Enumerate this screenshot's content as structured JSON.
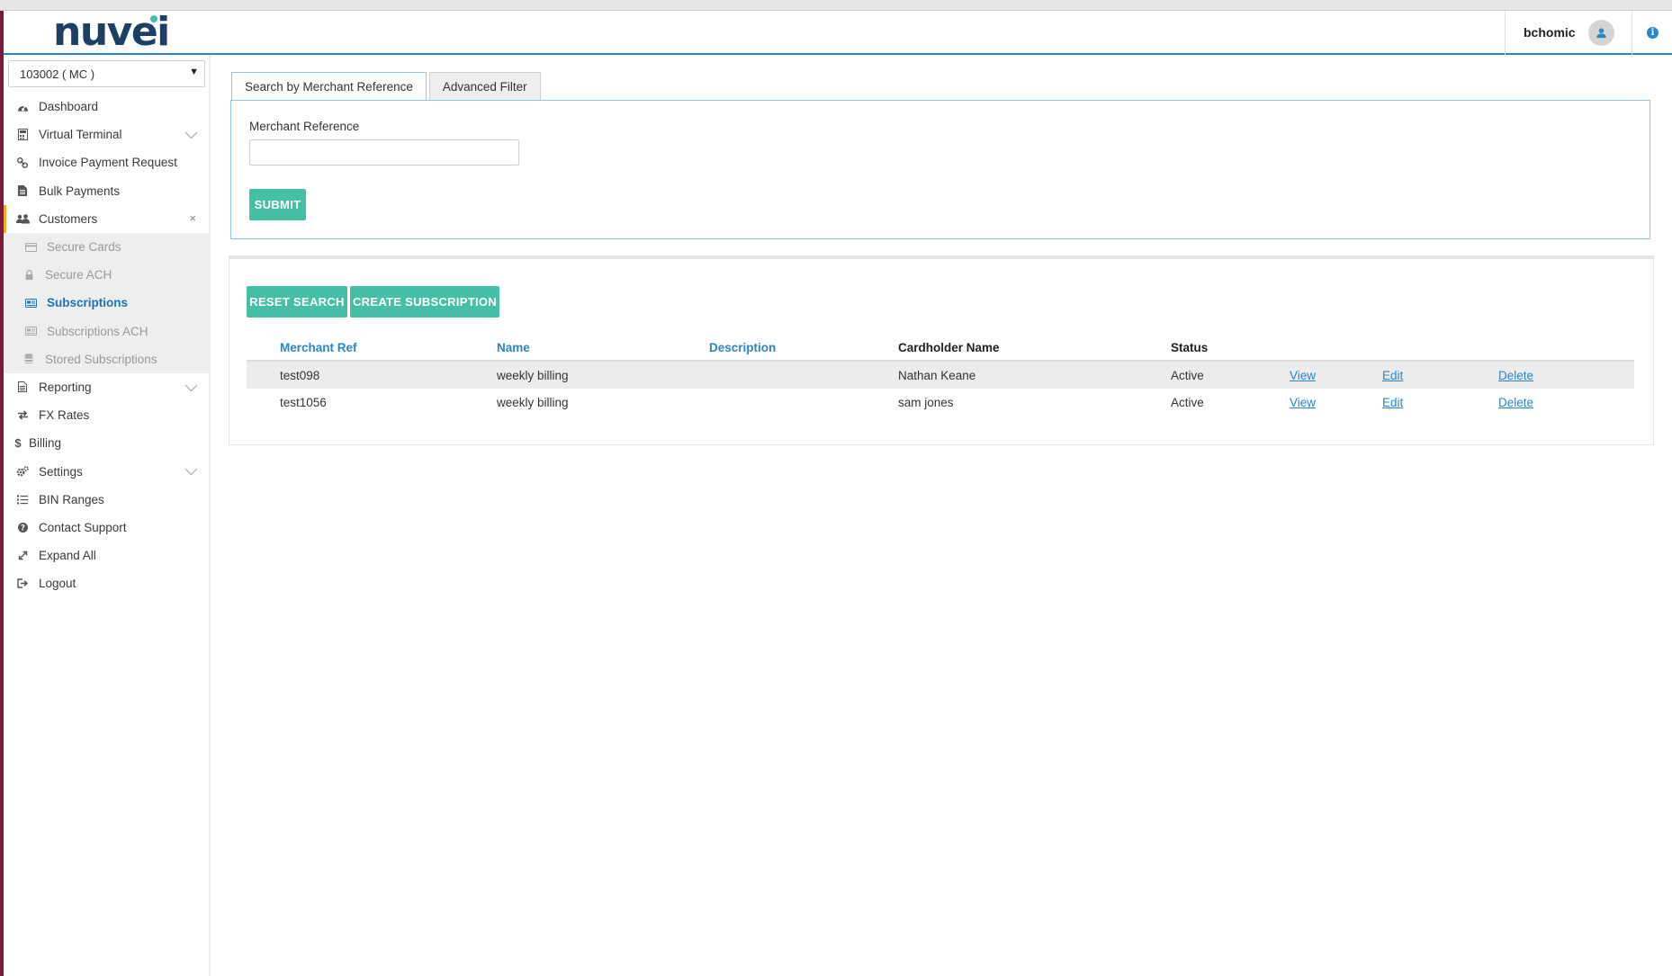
{
  "header": {
    "logo_text": "nuvei",
    "username": "bchomic"
  },
  "sidebar": {
    "account_select": "103002 ( MC )",
    "items": [
      {
        "label": "Dashboard",
        "icon": "dashboard-icon"
      },
      {
        "label": "Virtual Terminal",
        "icon": "calculator-icon",
        "expandable": true
      },
      {
        "label": "Invoice Payment Request",
        "icon": "link-icon"
      },
      {
        "label": "Bulk Payments",
        "icon": "file-icon"
      },
      {
        "label": "Customers",
        "icon": "users-icon",
        "active": true
      },
      {
        "label": "Reporting",
        "icon": "report-icon",
        "expandable": true
      },
      {
        "label": "FX Rates",
        "icon": "exchange-icon"
      },
      {
        "label": "Billing",
        "icon": "dollar-icon"
      },
      {
        "label": "Settings",
        "icon": "cogs-icon",
        "expandable": true
      },
      {
        "label": "BIN Ranges",
        "icon": "list-icon"
      },
      {
        "label": "Contact Support",
        "icon": "question-icon"
      },
      {
        "label": "Expand All",
        "icon": "expand-icon"
      },
      {
        "label": "Logout",
        "icon": "logout-icon"
      }
    ],
    "customers_sub": [
      {
        "label": "Secure Cards",
        "icon": "credit-card-icon"
      },
      {
        "label": "Secure ACH",
        "icon": "lock-icon"
      },
      {
        "label": "Subscriptions",
        "icon": "subscriptions-icon",
        "current": true
      },
      {
        "label": "Subscriptions ACH",
        "icon": "subscriptions-ach-icon"
      },
      {
        "label": "Stored Subscriptions",
        "icon": "database-icon"
      }
    ]
  },
  "tabs": [
    "Search by Merchant Reference",
    "Advanced Filter"
  ],
  "search": {
    "field_label": "Merchant Reference",
    "field_value": "",
    "submit_label": "SUBMIT"
  },
  "actions": {
    "reset_label": "RESET SEARCH",
    "create_label": "CREATE SUBSCRIPTION"
  },
  "table": {
    "headers": {
      "merchant_ref": "Merchant Ref",
      "name": "Name",
      "description": "Description",
      "cardholder": "Cardholder Name",
      "status": "Status"
    },
    "rows": [
      {
        "merchant_ref": "test098",
        "name": "weekly billing",
        "description": "",
        "cardholder": "Nathan Keane",
        "status": "Active",
        "view": "View",
        "edit": "Edit",
        "delete": "Delete"
      },
      {
        "merchant_ref": "test1056",
        "name": "weekly billing",
        "description": "",
        "cardholder": "sam jones",
        "status": "Active",
        "view": "View",
        "edit": "Edit",
        "delete": "Delete"
      }
    ]
  },
  "colors": {
    "accent": "#2a86c4",
    "button": "#45bfa6",
    "active_marker": "#f5a623",
    "logo": "#1c3f63"
  }
}
